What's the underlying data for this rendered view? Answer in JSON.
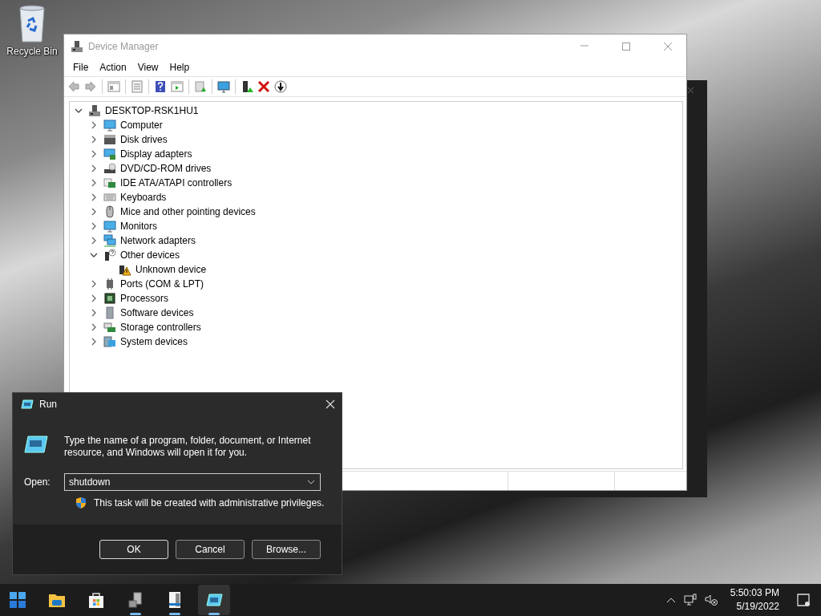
{
  "desktop_icons": [
    {
      "label": "Recycle Bin"
    }
  ],
  "device_manager": {
    "title": "Device Manager",
    "menu": [
      "File",
      "Action",
      "View",
      "Help"
    ],
    "tree": {
      "label": "DESKTOP-RSK1HU1",
      "kind": "root",
      "expanded": true,
      "children": [
        {
          "label": "Computer",
          "kind": "computer",
          "expanded": false
        },
        {
          "label": "Disk drives",
          "kind": "disk",
          "expanded": false
        },
        {
          "label": "Display adapters",
          "kind": "display",
          "expanded": false
        },
        {
          "label": "DVD/CD-ROM drives",
          "kind": "dvd",
          "expanded": false
        },
        {
          "label": "IDE ATA/ATAPI controllers",
          "kind": "ide",
          "expanded": false
        },
        {
          "label": "Keyboards",
          "kind": "keyboard",
          "expanded": false
        },
        {
          "label": "Mice and other pointing devices",
          "kind": "mouse",
          "expanded": false
        },
        {
          "label": "Monitors",
          "kind": "computer",
          "expanded": false
        },
        {
          "label": "Network adapters",
          "kind": "network",
          "expanded": false
        },
        {
          "label": "Other devices",
          "kind": "other",
          "expanded": true,
          "children": [
            {
              "label": "Unknown device",
              "kind": "unknown"
            }
          ]
        },
        {
          "label": "Ports (COM & LPT)",
          "kind": "ports",
          "expanded": false
        },
        {
          "label": "Processors",
          "kind": "processor",
          "expanded": false
        },
        {
          "label": "Software devices",
          "kind": "software",
          "expanded": false
        },
        {
          "label": "Storage controllers",
          "kind": "storage",
          "expanded": false
        },
        {
          "label": "System devices",
          "kind": "system",
          "expanded": false
        }
      ]
    }
  },
  "run_dialog": {
    "title": "Run",
    "description": "Type the name of a program, folder, document, or Internet resource, and Windows will open it for you.",
    "open_label": "Open:",
    "value": "shutdown",
    "admin_note": "This task will be created with administrative privileges.",
    "buttons": [
      {
        "label": "OK",
        "default": true
      },
      {
        "label": "Cancel",
        "default": false
      },
      {
        "label": "Browse...",
        "default": false
      }
    ]
  },
  "taskbar": {
    "apps": [
      {
        "kind": "start",
        "running": false,
        "selected": false
      },
      {
        "kind": "explorer",
        "running": false,
        "selected": false
      },
      {
        "kind": "store",
        "running": false,
        "selected": false
      },
      {
        "kind": "devmgr",
        "running": true,
        "selected": false
      },
      {
        "kind": "notepad",
        "running": true,
        "selected": false
      },
      {
        "kind": "run",
        "running": true,
        "selected": true
      }
    ],
    "time": "5:50:03 PM",
    "date": "5/19/2022"
  }
}
